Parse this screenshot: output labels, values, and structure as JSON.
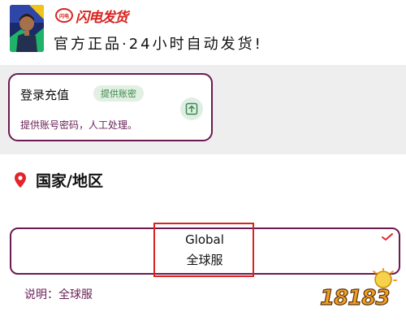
{
  "header": {
    "brand_name": "闪电发货",
    "brand_mark": "闪电",
    "slogan": "官方正品·24小时自动发货!"
  },
  "login_card": {
    "title": "登录充值",
    "badge": "提供账密",
    "description": "提供账号密码，人工处理。",
    "action_icon": "upload-icon"
  },
  "region": {
    "icon": "location-pin-icon",
    "title": "国家/地区",
    "option": {
      "name_en": "Global",
      "name_cn": "全球服",
      "selected": true
    },
    "note": "说明：全球服"
  },
  "watermark": {
    "text": "18183"
  },
  "colors": {
    "accent": "#6b1a52",
    "brand_red": "#d9231f",
    "badge_bg": "#e2efe3",
    "badge_text": "#3d8a4b",
    "note_text": "#6a2358"
  }
}
